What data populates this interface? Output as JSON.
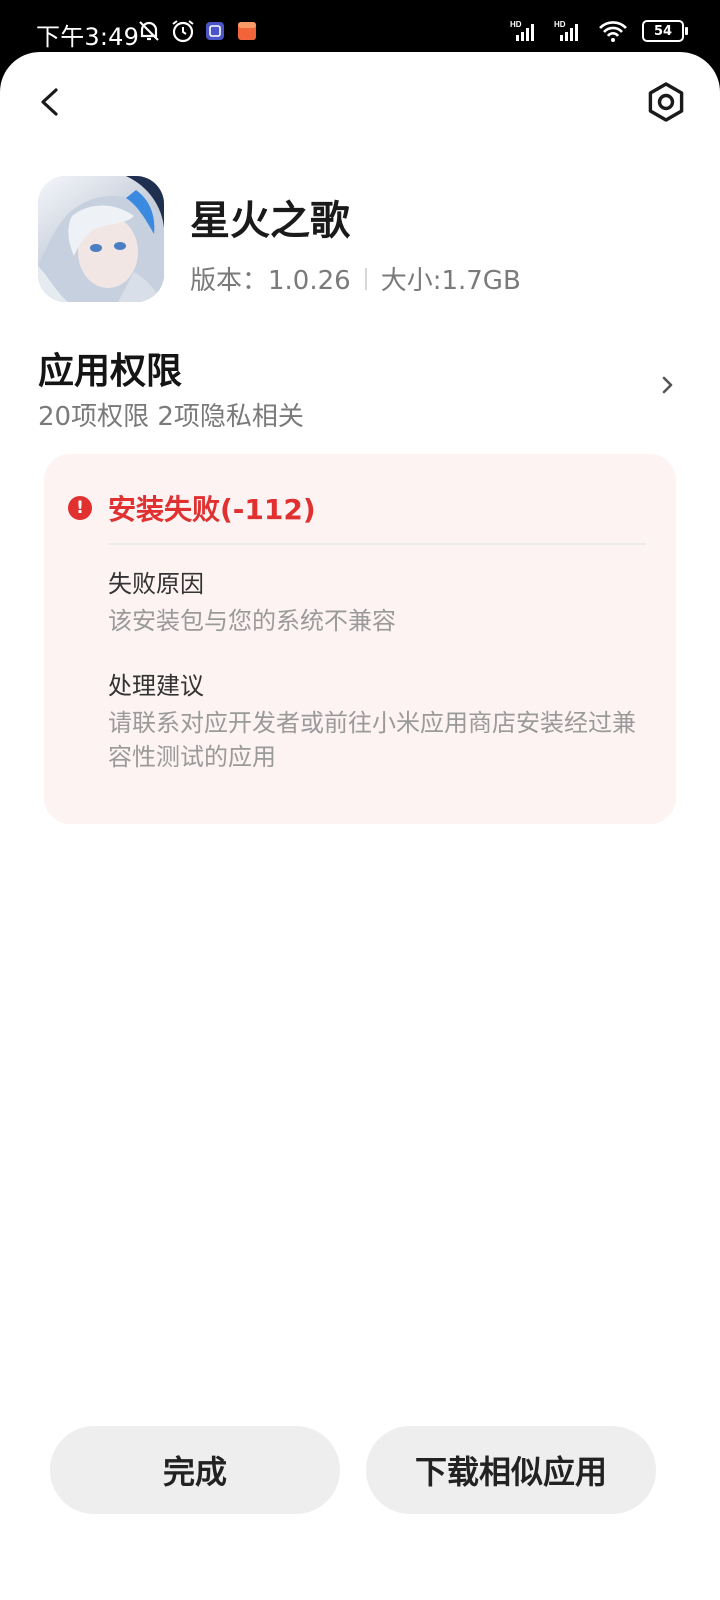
{
  "status_bar": {
    "time": "下午3:49",
    "battery": "54",
    "icons": [
      "mute-icon",
      "alarm-icon",
      "app-notification-icon",
      "app-notification-icon",
      "signal-hd-icon",
      "signal-hd-icon",
      "wifi-icon",
      "battery-icon"
    ]
  },
  "header": {
    "back_icon": "chevron-left-icon",
    "settings_icon": "gear-icon"
  },
  "app": {
    "name": "星火之歌",
    "version": "版本：1.0.26",
    "size": "大小:1.7GB"
  },
  "permissions": {
    "title": "应用权限",
    "subtitle": "20项权限 2项隐私相关"
  },
  "failure": {
    "title": "安装失败(-112)",
    "reason_label": "失败原因",
    "reason_text": "该安装包与您的系统不兼容",
    "suggestion_label": "处理建议",
    "suggestion_text": "请联系对应开发者或前往小米应用商店安装经过兼容性测试的应用",
    "accent_color": "#e0302f"
  },
  "buttons": {
    "done": "完成",
    "download_similar": "下载相似应用"
  }
}
